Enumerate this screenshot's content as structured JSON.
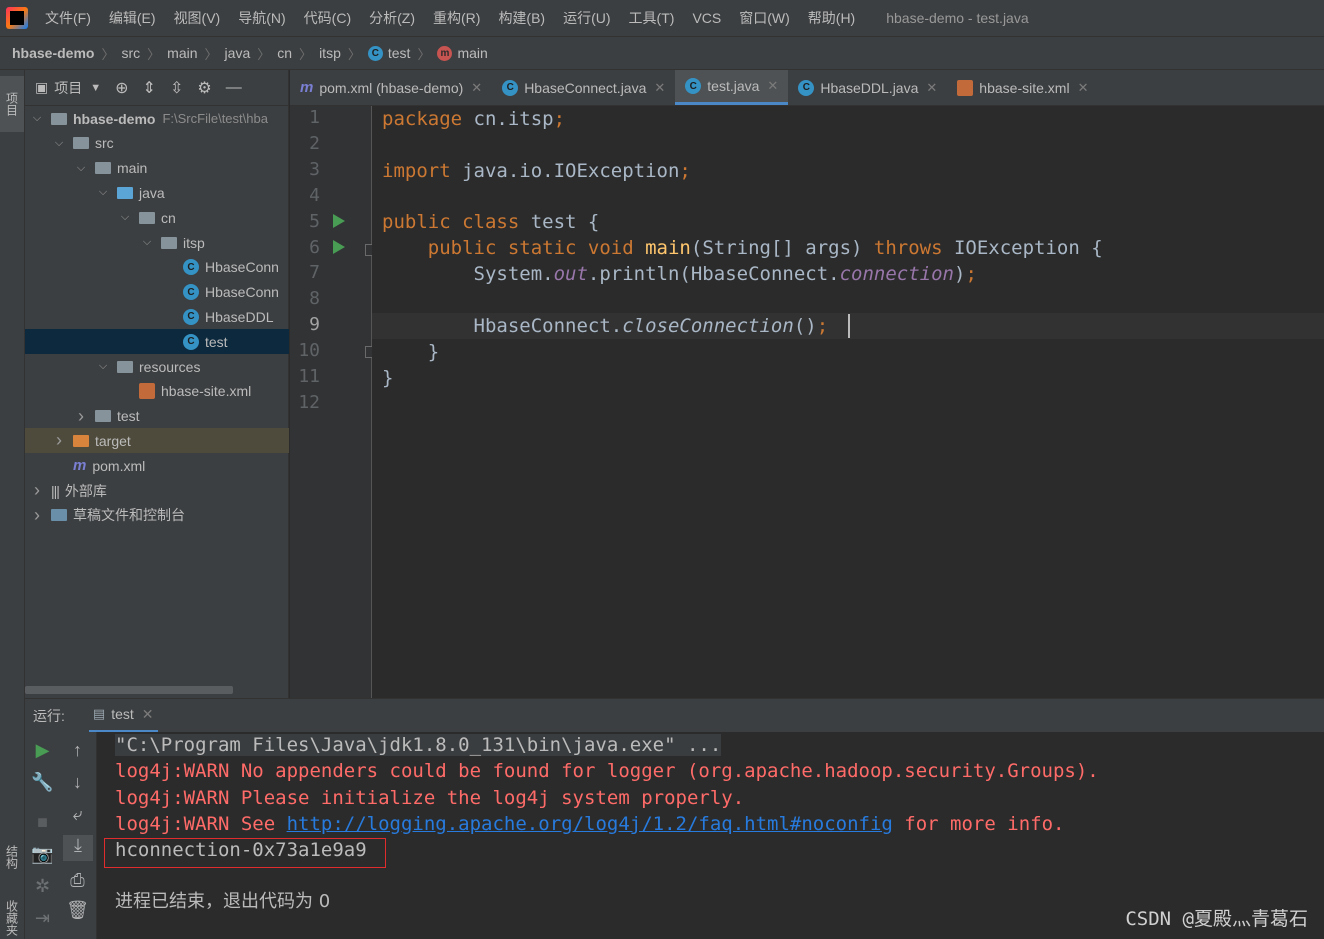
{
  "window": {
    "title": "hbase-demo - test.java",
    "menu": [
      "文件(F)",
      "编辑(E)",
      "视图(V)",
      "导航(N)",
      "代码(C)",
      "分析(Z)",
      "重构(R)",
      "构建(B)",
      "运行(U)",
      "工具(T)",
      "VCS",
      "窗口(W)",
      "帮助(H)"
    ]
  },
  "breadcrumb": [
    "hbase-demo",
    "src",
    "main",
    "java",
    "cn",
    "itsp",
    "test",
    "main"
  ],
  "left_stripe": {
    "top_tab": "项目",
    "bottom_tab_1": "结构",
    "bottom_tab_2": "收藏夹"
  },
  "project_panel": {
    "title": "项目",
    "tree": [
      {
        "label": "hbase-demo",
        "suffix": "F:\\SrcFile\\test\\hba",
        "indent": 0,
        "arrow": "v",
        "icon": "folder"
      },
      {
        "label": "src",
        "indent": 1,
        "arrow": "v",
        "icon": "folder"
      },
      {
        "label": "main",
        "indent": 2,
        "arrow": "v",
        "icon": "folder"
      },
      {
        "label": "java",
        "indent": 3,
        "arrow": "v",
        "icon": "folder-blue"
      },
      {
        "label": "cn",
        "indent": 4,
        "arrow": "v",
        "icon": "package"
      },
      {
        "label": "itsp",
        "indent": 5,
        "arrow": "v",
        "icon": "package"
      },
      {
        "label": "HbaseConn",
        "indent": 6,
        "arrow": "",
        "icon": "class"
      },
      {
        "label": "HbaseConn",
        "indent": 6,
        "arrow": "",
        "icon": "class"
      },
      {
        "label": "HbaseDDL",
        "indent": 6,
        "arrow": "",
        "icon": "class"
      },
      {
        "label": "test",
        "indent": 6,
        "arrow": "",
        "icon": "class",
        "selected": true
      },
      {
        "label": "resources",
        "indent": 3,
        "arrow": "v",
        "icon": "folder"
      },
      {
        "label": "hbase-site.xml",
        "indent": 4,
        "arrow": "",
        "icon": "xml"
      },
      {
        "label": "test",
        "indent": 2,
        "arrow": ">",
        "icon": "folder"
      },
      {
        "label": "target",
        "indent": 1,
        "arrow": ">",
        "icon": "folder-orange",
        "dim": true
      },
      {
        "label": "pom.xml",
        "indent": 1,
        "arrow": "",
        "icon": "maven"
      },
      {
        "label": "外部库",
        "indent": 0,
        "arrow": ">",
        "icon": "library"
      },
      {
        "label": "草稿文件和控制台",
        "indent": 0,
        "arrow": ">",
        "icon": "scratch"
      }
    ]
  },
  "editor_tabs": [
    {
      "label": "pom.xml (hbase-demo)",
      "icon": "maven"
    },
    {
      "label": "HbaseConnect.java",
      "icon": "class"
    },
    {
      "label": "test.java",
      "icon": "class",
      "active": true
    },
    {
      "label": "HbaseDDL.java",
      "icon": "class"
    },
    {
      "label": "hbase-site.xml",
      "icon": "xml"
    }
  ],
  "code": {
    "line_numbers": [
      "1",
      "2",
      "3",
      "4",
      "5",
      "6",
      "7",
      "8",
      "9",
      "10",
      "11",
      "12"
    ],
    "current_line": "9",
    "lines": {
      "l1_kw": "package",
      "l1_rest": " cn.itsp",
      "l1_semi": ";",
      "l3_kw": "import",
      "l3_rest": " java.io.IOException",
      "l3_semi": ";",
      "l5_kw": "public class",
      "l5_rest": " test {",
      "l6_indent": "    ",
      "l6_kw": "public static void",
      "l6_fn": " main",
      "l6_rest": "(String[] args) ",
      "l6_kw2": "throws",
      "l6_rest2": " IOException {",
      "l7_a": "        System.",
      "l7_fld": "out",
      "l7_b": ".println(HbaseConnect.",
      "l7_fld2": "connection",
      "l7_c": ")",
      "l7_semi": ";",
      "l9_a": "        HbaseConnect.",
      "l9_ital": "closeConnection",
      "l9_b": "()",
      "l9_semi": ";",
      "l10": "    }",
      "l11": "}"
    }
  },
  "run_panel": {
    "label": "运行:",
    "tab": "test",
    "console": {
      "cmd": "\"C:\\Program Files\\Java\\jdk1.8.0_131\\bin\\java.exe\" ...",
      "warn1": "log4j:WARN No appenders could be found for logger (org.apache.hadoop.security.Groups).",
      "warn2": "log4j:WARN Please initialize the log4j system properly.",
      "warn3_a": "log4j:WARN See ",
      "warn3_link": "http://logging.apache.org/log4j/1.2/faq.html#noconfig",
      "warn3_b": " for more info.",
      "output": "hconnection-0x73a1e9a9",
      "exit": "进程已结束，退出代码为 0"
    }
  },
  "watermark": "CSDN @夏殿灬青葛石",
  "colors": {
    "keyword": "#cc7832",
    "method": "#ffc66d",
    "field": "#9876aa",
    "error": "#ff6b68",
    "link": "#287bde",
    "accent": "#4a88c7"
  }
}
